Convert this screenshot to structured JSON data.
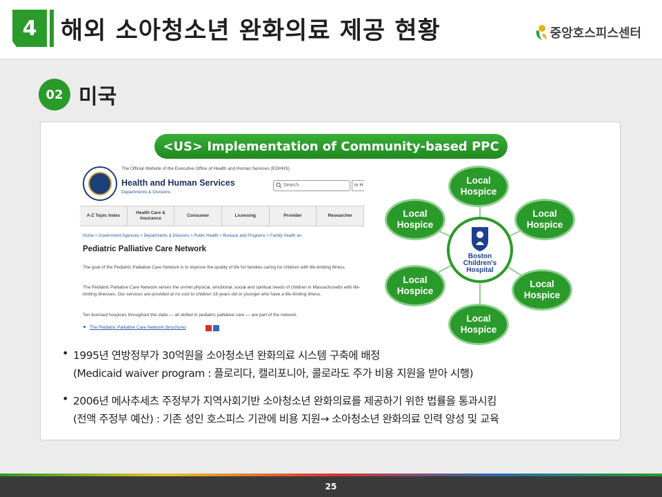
{
  "header": {
    "section_number": "4",
    "title": "해외 소아청소년 완화의료 제공 현황",
    "logo_text": "중앙호스피스센터"
  },
  "subsection": {
    "number": "02",
    "title": "미국"
  },
  "panel": {
    "banner": "<US> Implementation of Community-based PPC",
    "website": {
      "official_line": "The Official Website of the Executive Office of Health and Human Services (EOHHS)",
      "name": "Health and Human Services",
      "departments_link": "Departments & Divisions",
      "search_placeholder": "Search...",
      "search_scope": "in H",
      "nav": [
        "A-Z Topic Index",
        "Health Care & Insurance",
        "Consumer",
        "Licensing",
        "Provider",
        "Researcher"
      ],
      "breadcrumbs": "Home  >  Government Agencies  >  Departments & Divisions  >  Public Health  >  Bureaus and Programs  >  Family Health an",
      "heading": "Pediatric Palliative Care Network",
      "paragraphs": [
        "The goal of the Pediatric Palliative Care Network is to improve the quality of life for families caring for children with life-limiting illness.",
        "The Pediatric Palliative Care Network serves the unmet physical, emotional, social and spiritual needs of children in Massachusetts with life-limiting illnesses. Our services are provided at no cost to children 18 years old or younger who have a life-limiting illness.",
        "Ten licensed hospices throughout the state — all skilled in pediatric palliative care — are part of the network."
      ],
      "link": "The Pediatric Palliative Care Network (brochure)"
    },
    "diagram": {
      "nodes": [
        "Local Hospice",
        "Local Hospice",
        "Local Hospice",
        "Local Hospice",
        "Local Hospice",
        "Local Hospice"
      ],
      "center_label": [
        "Boston",
        "Children's",
        "Hospital"
      ]
    }
  },
  "bullets": [
    {
      "line1": "1995년 연방정부가 30억원을 소아청소년 완화의료 시스템 구축에 배정",
      "line2": "(Medicaid waiver program : 플로리다, 캘리포니아, 콜로라도 주가 비용 지원을 받아 시행)"
    },
    {
      "line1": "2006년 메사추세츠 주정부가 지역사회기반 소아청소년 완화의료를 제공하기 위한 법률을 통과시킴",
      "line2": "(전액 주정부 예산) : 기존 성인 호스피스 기관에 비용 지원→ 소아청소년 완화의료 인력 양성 및 교육"
    }
  ],
  "footer": {
    "page_number": "25"
  },
  "colors": {
    "accent_green": "#2a9a2a",
    "footer_bg": "#3a3a3a"
  }
}
